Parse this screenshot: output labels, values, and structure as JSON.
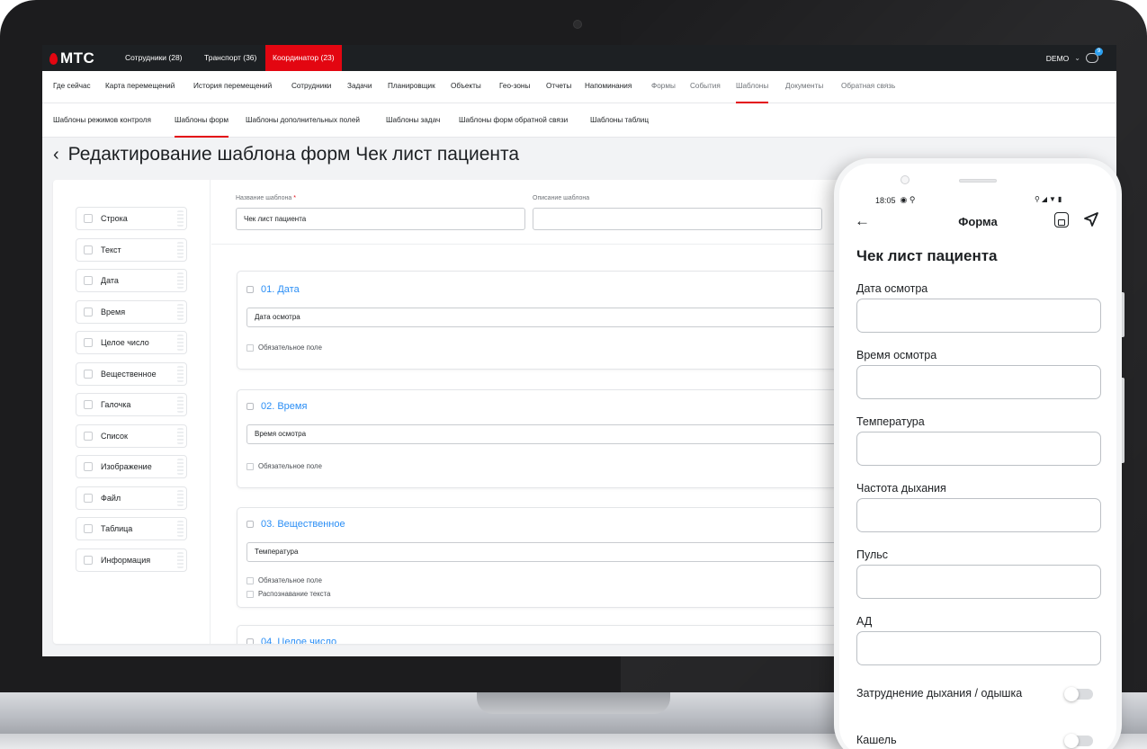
{
  "app": {
    "logo_text": "МТС",
    "top_tabs": [
      {
        "label": "Сотрудники (28)"
      },
      {
        "label": "Транспорт (36)"
      },
      {
        "label": "Координатор (23)"
      }
    ],
    "account_label": "DEMO",
    "chat_badge": "9"
  },
  "menu": {
    "items": [
      {
        "label": "Где сейчас"
      },
      {
        "label": "Карта перемещений"
      },
      {
        "label": "История перемещений"
      },
      {
        "label": "Сотрудники"
      },
      {
        "label": "Задачи"
      },
      {
        "label": "Планировщик"
      },
      {
        "label": "Объекты"
      },
      {
        "label": "Гео-зоны"
      },
      {
        "label": "Отчеты"
      },
      {
        "label": "Напоминания"
      },
      {
        "label": "Формы"
      },
      {
        "label": "События"
      },
      {
        "label": "Шаблоны"
      },
      {
        "label": "Документы"
      },
      {
        "label": "Обратная связь"
      }
    ],
    "active": "Шаблоны"
  },
  "submenu": {
    "items": [
      {
        "label": "Шаблоны режимов контроля"
      },
      {
        "label": "Шаблоны форм"
      },
      {
        "label": "Шаблоны дополнительных полей"
      },
      {
        "label": "Шаблоны задач"
      },
      {
        "label": "Шаблоны форм обратной связи"
      },
      {
        "label": "Шаблоны таблиц"
      }
    ],
    "active": "Шаблоны форм"
  },
  "page": {
    "title": "Редактирование шаблона форм Чек лист пациента"
  },
  "palette": {
    "items": [
      {
        "label": "Строка",
        "icon": "pencil-icon"
      },
      {
        "label": "Текст",
        "icon": "text-icon"
      },
      {
        "label": "Дата",
        "icon": "calendar-icon"
      },
      {
        "label": "Время",
        "icon": "clock-icon"
      },
      {
        "label": "Целое число",
        "icon": "number-icon"
      },
      {
        "label": "Вещественное",
        "icon": "decimal-icon"
      },
      {
        "label": "Галочка",
        "icon": "checkbox-icon"
      },
      {
        "label": "Список",
        "icon": "list-icon"
      },
      {
        "label": "Изображение",
        "icon": "image-icon"
      },
      {
        "label": "Файл",
        "icon": "file-icon"
      },
      {
        "label": "Таблица",
        "icon": "table-icon"
      },
      {
        "label": "Информация",
        "icon": "info-icon"
      }
    ]
  },
  "template": {
    "name_label": "Название шаблона",
    "name_value": "Чек лист пациента",
    "description_label": "Описание шаблона",
    "description_value": ""
  },
  "fields": [
    {
      "title": "01. Дата",
      "icon": "calendar-icon",
      "value": "Дата осмотра",
      "checks": [
        "Обязательное поле"
      ]
    },
    {
      "title": "02. Время",
      "icon": "clock-icon",
      "value": "Время осмотра",
      "checks": [
        "Обязательное поле"
      ]
    },
    {
      "title": "03. Вещественное",
      "icon": "decimal-icon",
      "value": "Температура",
      "checks": [
        "Обязательное поле",
        "Распознавание текста"
      ]
    },
    {
      "title": "04. Целое число",
      "icon": "number-icon"
    }
  ],
  "phone": {
    "status_time": "18:05",
    "header_title": "Форма",
    "form_title": "Чек лист пациента",
    "fields": [
      {
        "label": "Дата осмотра"
      },
      {
        "label": "Время осмотра"
      },
      {
        "label": "Температура"
      },
      {
        "label": "Частота дыхания"
      },
      {
        "label": "Пульс"
      },
      {
        "label": "АД"
      }
    ],
    "toggles": [
      {
        "label": "Затруднение дыхания / одышка",
        "on": false
      },
      {
        "label": "Кашель",
        "on": false
      }
    ]
  },
  "colors": {
    "brand_red": "#e30611",
    "link_blue": "#2a8ef5",
    "dark_bar": "#1d2023"
  }
}
